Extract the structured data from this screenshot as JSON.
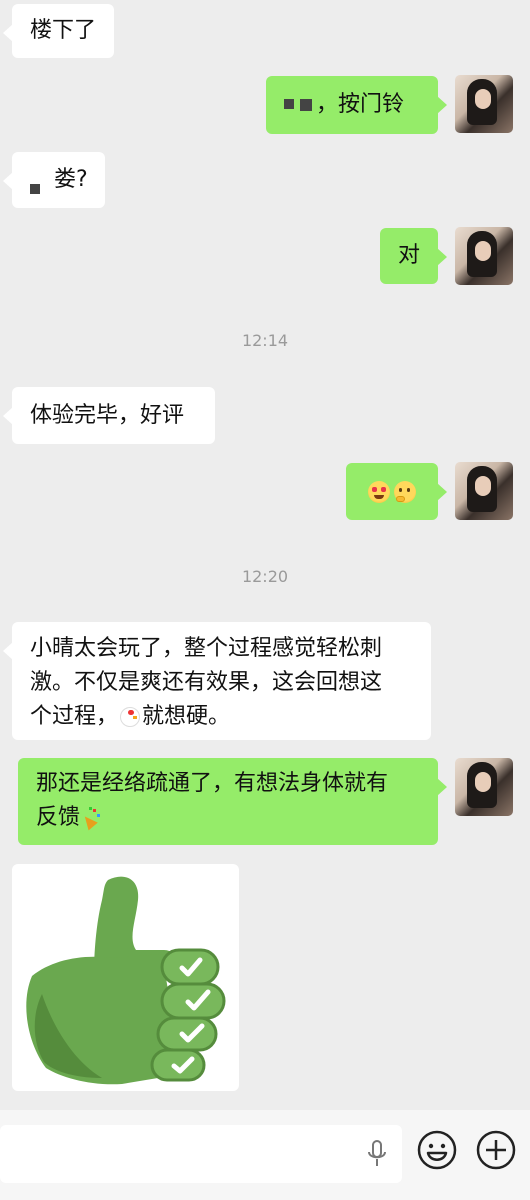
{
  "messages": [
    {
      "side": "left",
      "text": "楼下了"
    },
    {
      "side": "right",
      "text": "，按门铃"
    },
    {
      "side": "left",
      "text": "娄?"
    },
    {
      "side": "right",
      "text": "对"
    },
    {
      "side": "time",
      "text": "12:14"
    },
    {
      "side": "left",
      "text": "体验完毕，好评"
    },
    {
      "side": "right",
      "emoji": [
        "heart-eyes-face-emoji",
        "thinking-face-emoji"
      ]
    },
    {
      "side": "time",
      "text": "12:20"
    },
    {
      "side": "left",
      "lines": [
        "小晴太会玩了，整个过程感觉轻松刺",
        "激。不仅是爽还有效果，这会回想这",
        "个过程，",
        "就想硬。"
      ]
    },
    {
      "side": "right",
      "lines": [
        "那还是经络疏通了，有想法身体就有",
        "反馈"
      ]
    },
    {
      "side": "left",
      "sticker": "thumbs-up-sticker"
    }
  ],
  "colors": {
    "background": "#ededed",
    "incoming_bubble": "#ffffff",
    "outgoing_bubble": "#95ec69",
    "timestamp": "#9a9a9a",
    "sticker_green": "#6aa84f"
  },
  "input_bar": {
    "icons": [
      "microphone-icon",
      "emoji-face-icon",
      "plus-circle-icon"
    ]
  }
}
